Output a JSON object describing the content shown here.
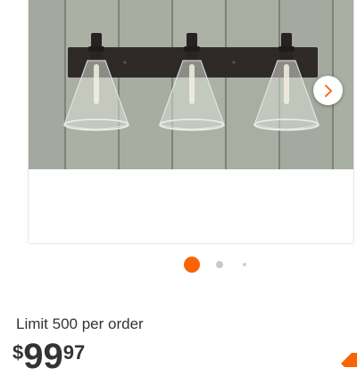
{
  "product": {
    "image_alt": "Three-light vanity fixture with clear glass shades on dark bronze backplate",
    "limit_text": "Limit 500 per order",
    "price": {
      "currency": "$",
      "whole": "99",
      "cents": "97"
    }
  },
  "carousel": {
    "next_icon": "chevron-right-icon",
    "active_index": 1,
    "dot_count": 3
  },
  "colors": {
    "accent": "#f96302",
    "dot_inactive": "#c8c8c8",
    "dot_small": "#d0d0d0",
    "chevron": "#f96302",
    "text": "#333333"
  }
}
